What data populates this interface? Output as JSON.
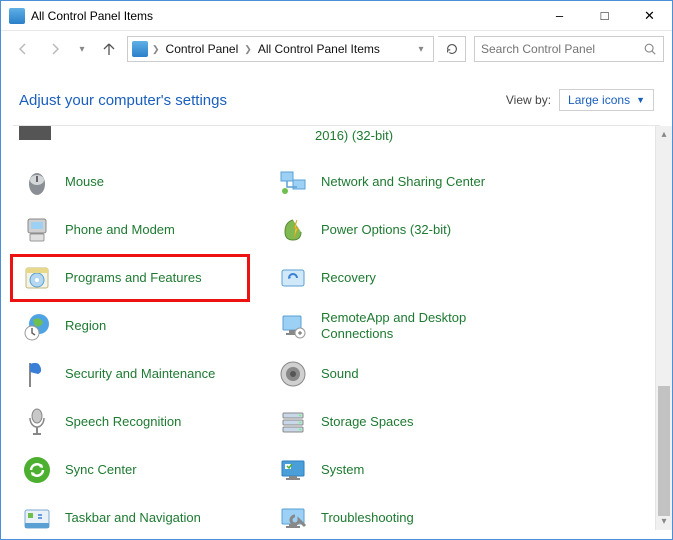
{
  "window": {
    "title": "All Control Panel Items"
  },
  "breadcrumb": {
    "root": "Control Panel",
    "current": "All Control Panel Items"
  },
  "search": {
    "placeholder": "Search Control Panel"
  },
  "header": {
    "title": "Adjust your computer's settings"
  },
  "viewby": {
    "label": "View by:",
    "selected": "Large icons"
  },
  "cut_item": {
    "label": "2016) (32-bit)"
  },
  "left_items": [
    {
      "label": "Mouse",
      "icon": "mouse"
    },
    {
      "label": "Phone and Modem",
      "icon": "phone"
    },
    {
      "label": "Programs and Features",
      "icon": "programs",
      "highlight": true
    },
    {
      "label": "Region",
      "icon": "region"
    },
    {
      "label": "Security and Maintenance",
      "icon": "flag"
    },
    {
      "label": "Speech Recognition",
      "icon": "mic"
    },
    {
      "label": "Sync Center",
      "icon": "sync"
    },
    {
      "label": "Taskbar and Navigation",
      "icon": "taskbar"
    }
  ],
  "right_items": [
    {
      "label": "Network and Sharing Center",
      "icon": "network"
    },
    {
      "label": "Power Options (32-bit)",
      "icon": "power"
    },
    {
      "label": "Recovery",
      "icon": "recovery"
    },
    {
      "label": "RemoteApp and Desktop Connections",
      "icon": "remote"
    },
    {
      "label": "Sound",
      "icon": "sound"
    },
    {
      "label": "Storage Spaces",
      "icon": "storage"
    },
    {
      "label": "System",
      "icon": "system"
    },
    {
      "label": "Troubleshooting",
      "icon": "troubleshoot"
    }
  ]
}
